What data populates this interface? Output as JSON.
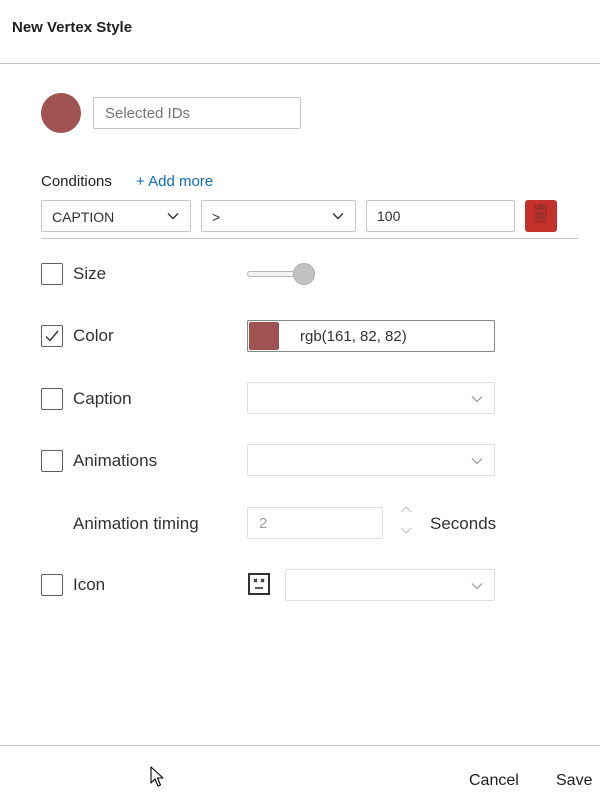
{
  "dialog": {
    "title": "New Vertex Style"
  },
  "style_color": "#a15252",
  "name_field": {
    "value": "",
    "placeholder": "Selected IDs"
  },
  "conditions": {
    "label": "Conditions",
    "add_more": "+ Add more",
    "items": [
      {
        "field": "CAPTION",
        "operator": ">",
        "value": "100",
        "delete_color": "#c4312b"
      }
    ]
  },
  "options": {
    "size": {
      "label": "Size",
      "checked": false,
      "slider_fraction": 0.85
    },
    "color": {
      "label": "Color",
      "checked": true,
      "value": "rgb(161, 82, 82)"
    },
    "caption": {
      "label": "Caption",
      "checked": false,
      "selected": ""
    },
    "animations": {
      "label": "Animations",
      "checked": false,
      "selected": ""
    },
    "animation_timing": {
      "label": "Animation timing",
      "value": "2",
      "unit": "Seconds"
    },
    "icon": {
      "label": "Icon",
      "checked": false,
      "selected": "",
      "glyph": "face-placeholder-icon"
    }
  },
  "footer": {
    "cancel_label": "Cancel",
    "save_label": "Save"
  }
}
